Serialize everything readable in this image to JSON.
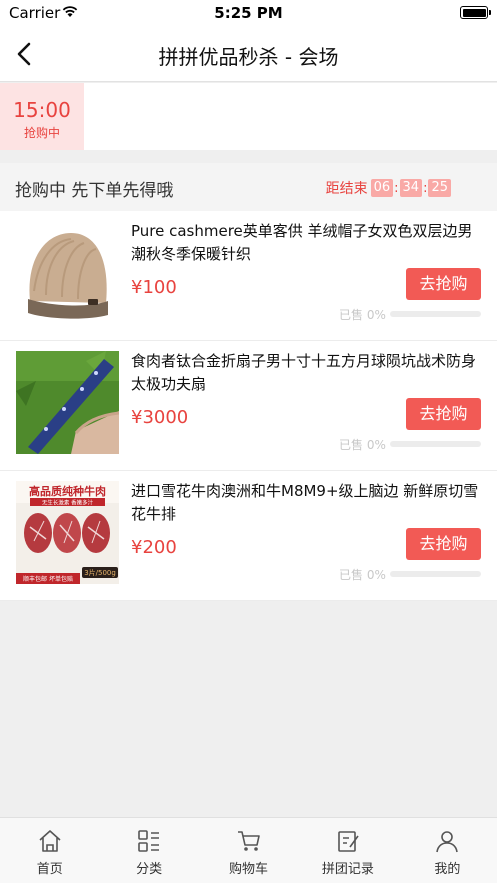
{
  "status_bar": {
    "carrier": "Carrier",
    "time": "5:25 PM"
  },
  "nav": {
    "title": "拼拼优品秒杀 - 会场"
  },
  "time_tabs": [
    {
      "time": "15:00",
      "status": "抢购中"
    }
  ],
  "section": {
    "title": "抢购中 先下单先得哦",
    "countdown_label": "距结束",
    "countdown": [
      "06",
      "34",
      "25"
    ]
  },
  "products": [
    {
      "name": "Pure cashmere英单客供 羊绒帽子女双色双层边男潮秋冬季保暖针织",
      "price": "¥100",
      "buy_label": "去抢购",
      "sold": "已售 0%",
      "sold_fraction": 0,
      "thumb_icon": "knit-beanie-image"
    },
    {
      "name": "食肉者钛合金折扇子男十寸十五方月球陨坑战术防身太极功夫扇",
      "price": "¥3000",
      "buy_label": "去抢购",
      "sold": "已售 0%",
      "sold_fraction": 0,
      "thumb_icon": "folding-fan-image"
    },
    {
      "name": "进口雪花牛肉澳洲和牛M8M9+级上脑边 新鲜原切雪花牛排",
      "price": "¥200",
      "buy_label": "去抢购",
      "sold": "已售 0%",
      "sold_fraction": 0,
      "thumb_icon": "beef-steak-image",
      "thumb_text": {
        "headline": "高品质纯种牛肉",
        "sub": "无生长激素 香嫩多汁",
        "badge": "3片/500g",
        "footer": "顺丰包邮 坏单包赔"
      }
    }
  ],
  "tab_bar": [
    {
      "label": "首页",
      "icon": "home-icon"
    },
    {
      "label": "分类",
      "icon": "category-icon"
    },
    {
      "label": "购物车",
      "icon": "cart-icon"
    },
    {
      "label": "拼团记录",
      "icon": "group-record-icon"
    },
    {
      "label": "我的",
      "icon": "profile-icon"
    }
  ],
  "colors": {
    "accent": "#e8433f",
    "button": "#f25a55",
    "time_tab_bg": "#fde3e3",
    "countdown_box": "#f9a9a6"
  }
}
